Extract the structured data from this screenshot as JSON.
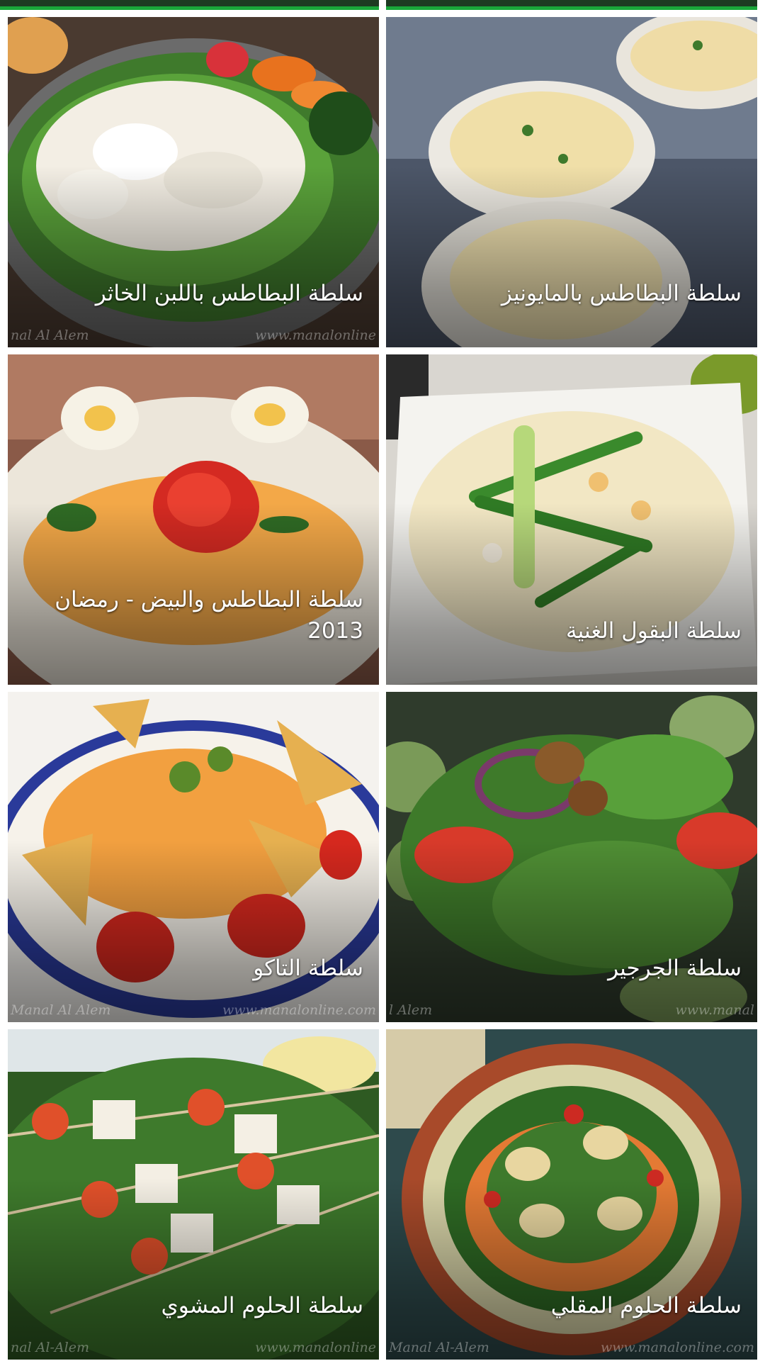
{
  "recipes": [
    {
      "title": "سلطة البطاطس باللبن الخاثر",
      "watermark_left": "nal Al Alem",
      "watermark_right": "www.manalonline"
    },
    {
      "title": "سلطة البطاطس بالمايونيز",
      "watermark_left": "",
      "watermark_right": ""
    },
    {
      "title": "سلطة البطاطس والبيض - رمضان 2013",
      "watermark_left": "",
      "watermark_right": ""
    },
    {
      "title": "سلطة البقول الغنية",
      "watermark_left": "",
      "watermark_right": ""
    },
    {
      "title": "سلطة التاكو",
      "watermark_left": "Manal Al Alem",
      "watermark_right": "www.manalonline.com"
    },
    {
      "title": "سلطة الجرجير",
      "watermark_left": "l Alem",
      "watermark_right": "www.manal"
    },
    {
      "title": "سلطة الحلوم المشوي",
      "watermark_left": "nal Al-Alem",
      "watermark_right": "www.manalonline"
    },
    {
      "title": "سلطة الحلوم المقلي",
      "watermark_left": "Manal Al-Alem",
      "watermark_right": "www.manalonline.com"
    }
  ],
  "colors": {
    "accent_green": "#19a63a",
    "caption": "#ffffff"
  }
}
